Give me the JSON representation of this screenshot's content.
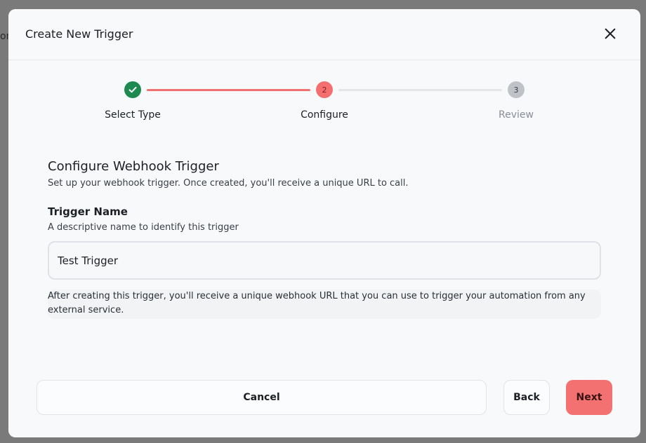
{
  "backdrop": {
    "peek_text": "on"
  },
  "dialog": {
    "title": "Create New Trigger",
    "close_icon": "close-icon"
  },
  "stepper": {
    "steps": [
      {
        "label": "Select Type",
        "state": "completed",
        "indicator": "check-icon"
      },
      {
        "label": "Configure",
        "state": "active",
        "indicator": "2"
      },
      {
        "label": "Review",
        "state": "pending",
        "indicator": "3"
      }
    ],
    "colors": {
      "completed": "#1e8a4f",
      "active": "#f47070",
      "pending": "#bfc2c7"
    }
  },
  "form": {
    "section_title": "Configure Webhook Trigger",
    "section_subtitle": "Set up your webhook trigger. Once created, you'll receive a unique URL to call.",
    "trigger_name_label": "Trigger Name",
    "trigger_name_help": "A descriptive name to identify this trigger",
    "trigger_name_value": "Test Trigger",
    "info_text": "After creating this trigger, you'll receive a unique webhook URL that you can use to trigger your automation from any external service."
  },
  "footer": {
    "cancel_label": "Cancel",
    "back_label": "Back",
    "next_label": "Next",
    "accent_color": "#f47171"
  }
}
